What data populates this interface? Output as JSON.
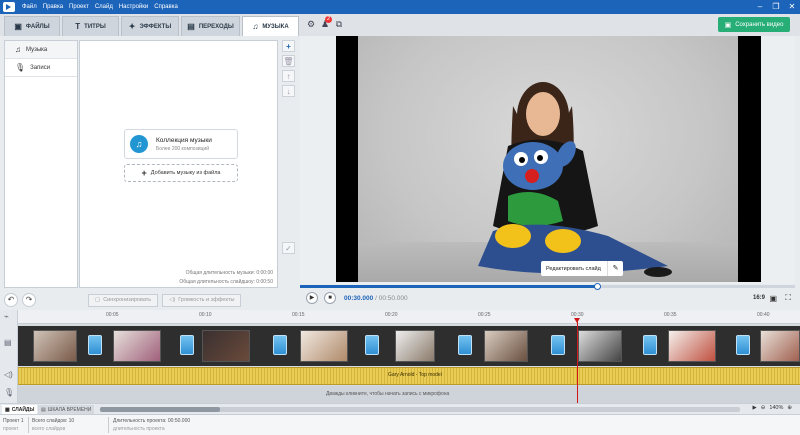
{
  "menu": [
    "Файл",
    "Правка",
    "Проект",
    "Слайд",
    "Настройки",
    "Справка"
  ],
  "tabs": [
    {
      "label": "ФАЙЛЫ",
      "icon": "folder-icon"
    },
    {
      "label": "ТИТРЫ",
      "icon": "text-icon"
    },
    {
      "label": "ЭФФЕКТЫ",
      "icon": "effects-icon"
    },
    {
      "label": "ПЕРЕХОДЫ",
      "icon": "transitions-icon"
    },
    {
      "label": "МУЗЫКА",
      "icon": "music-icon"
    }
  ],
  "notifications_count": "2",
  "save_button": "Сохранить видео",
  "sidebar": [
    {
      "label": "Музыка",
      "icon": "music-note-icon"
    },
    {
      "label": "Записи",
      "icon": "microphone-icon"
    }
  ],
  "music": {
    "collection_title": "Коллекция музыки",
    "collection_sub": "Более 200 композиций",
    "add_file": "Добавить музыку из файла",
    "total_music": "Общая длительность музыки: 0:00:00",
    "total_slideshow": "Общая длительность слайдшоу: 0:00:50"
  },
  "actions": {
    "sync": "Синхронизировать",
    "volume": "Громкость и эффекты"
  },
  "preview": {
    "edit_slide": "Редактировать слайд",
    "current_time": "00:30.000",
    "total_time": "00:50.000",
    "progress": 0.6,
    "aspect": "16:9"
  },
  "ruler": [
    "00:05",
    "00:10",
    "00:15",
    "00:20",
    "00:25",
    "00:30",
    "00:35",
    "00:40"
  ],
  "audio_track": "Gary Arnold - Top model",
  "mic_hint": "Дважды кликните, чтобы начать запись с микрофона",
  "bottom_tabs": [
    "СЛАЙДЫ",
    "ШКАЛА ВРЕМЕНИ"
  ],
  "zoom": "140%",
  "status": {
    "project": "Проект 1",
    "project2": "проект",
    "slides_count": "Всего слайдов: 10",
    "slides_count2": "всего слайдов",
    "duration": "Длительность проекта: 00:50.000",
    "duration2": "длительность проекта"
  }
}
